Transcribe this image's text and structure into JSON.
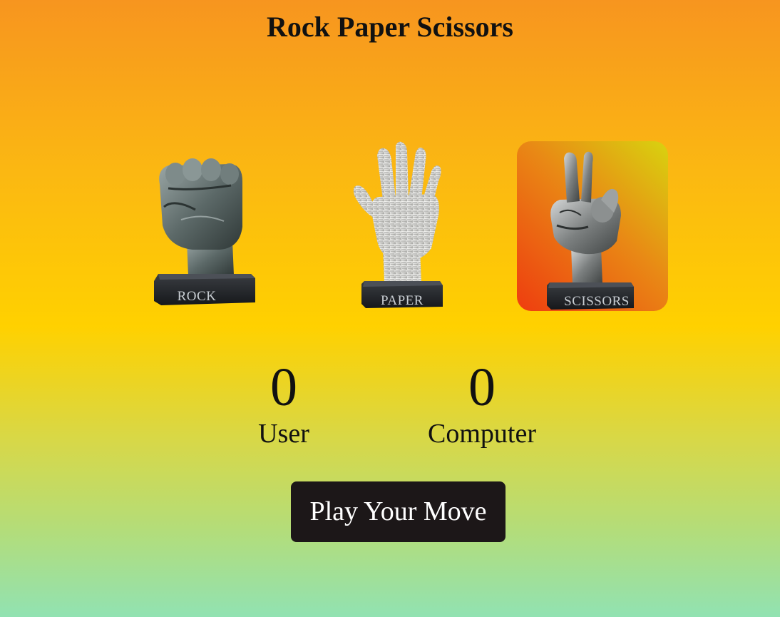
{
  "header": {
    "title": "Rock Paper Scissors"
  },
  "choices": [
    {
      "id": "rock",
      "label": "ROCK",
      "icon": "rock-fist-statue-icon",
      "selected": false
    },
    {
      "id": "paper",
      "label": "PAPER",
      "icon": "paper-hand-statue-icon",
      "selected": false
    },
    {
      "id": "scissors",
      "label": "SCISSORS",
      "icon": "scissors-hand-statue-icon",
      "selected": true
    }
  ],
  "scores": {
    "user": {
      "value": "0",
      "label": "User"
    },
    "computer": {
      "value": "0",
      "label": "Computer"
    }
  },
  "actions": {
    "play_label": "Play Your Move"
  },
  "colors": {
    "background_top": "#f7951f",
    "background_middle": "#ffd100",
    "background_bottom": "#91e2b2",
    "selected_gradient_start": "#d8d30f",
    "selected_gradient_end": "#ee3d0f",
    "button_background": "#1c1718",
    "button_text": "#ffffff"
  }
}
